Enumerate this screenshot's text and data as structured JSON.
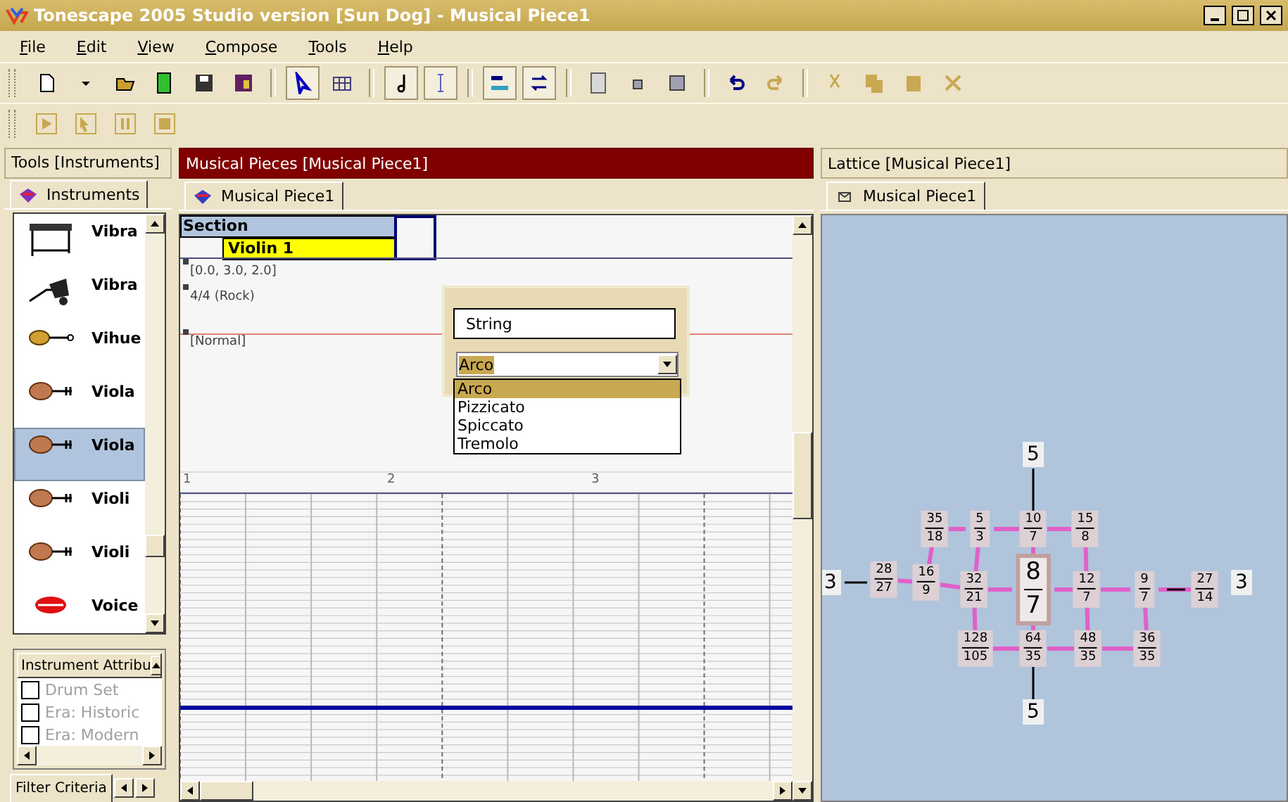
{
  "window": {
    "title": "Tonescape 2005 Studio  version [Sun Dog]  -  Musical Piece1"
  },
  "menu": [
    {
      "label": "File"
    },
    {
      "label": "Edit"
    },
    {
      "label": "View"
    },
    {
      "label": "Compose"
    },
    {
      "label": "Tools"
    },
    {
      "label": "Help"
    }
  ],
  "tools_panel": {
    "title": "Tools  [Instruments]",
    "tab": "Instruments",
    "instruments": [
      {
        "name": "Vibra",
        "kind": "vibraphone",
        "selected": false
      },
      {
        "name": "Vibra",
        "kind": "pedal",
        "selected": false
      },
      {
        "name": "Vihue",
        "kind": "guitar",
        "selected": false
      },
      {
        "name": "Viola",
        "kind": "violin",
        "selected": false
      },
      {
        "name": "Viola",
        "kind": "violin",
        "selected": true
      },
      {
        "name": "Violi",
        "kind": "violin",
        "selected": false
      },
      {
        "name": "Violi",
        "kind": "violin",
        "selected": false
      },
      {
        "name": "Voice",
        "kind": "lips",
        "selected": false
      }
    ],
    "attributes": {
      "title": "Instrument Attribu",
      "items": [
        {
          "label": "Drum Set",
          "checked": false
        },
        {
          "label": "Era: Historic",
          "checked": false
        },
        {
          "label": "Era: Modern",
          "checked": false
        }
      ]
    },
    "filter_tab": "Filter Criteria"
  },
  "pieces_panel": {
    "title": "Musical Pieces  [Musical Piece1]",
    "tab": "Musical Piece1",
    "section": {
      "header": "Section",
      "track": "Violin 1"
    },
    "markers": [
      "[0.0, 3.0, 2.0]",
      "4/4 (Rock)",
      "[Normal]"
    ],
    "popup": {
      "field_value": "String",
      "combo_value": "Arco",
      "options": [
        {
          "label": "Arco",
          "selected": true
        },
        {
          "label": "Pizzicato",
          "selected": false
        },
        {
          "label": "Spiccato",
          "selected": false
        },
        {
          "label": "Tremolo",
          "selected": false
        }
      ]
    },
    "ruler": [
      "1",
      "2",
      "3"
    ]
  },
  "lattice_panel": {
    "title": "Lattice  [Musical Piece1]",
    "tab": "Musical Piece1",
    "axes": [
      {
        "label": "5"
      },
      {
        "label": "5"
      },
      {
        "label": "3"
      },
      {
        "label": "3"
      }
    ],
    "nodes": [
      {
        "num": "35",
        "den": "18",
        "center": false
      },
      {
        "num": "5",
        "den": "3",
        "center": false
      },
      {
        "num": "10",
        "den": "7",
        "center": false
      },
      {
        "num": "15",
        "den": "8",
        "center": false
      },
      {
        "num": "28",
        "den": "27",
        "center": false
      },
      {
        "num": "16",
        "den": "9",
        "center": false
      },
      {
        "num": "32",
        "den": "21",
        "center": false
      },
      {
        "num": "8",
        "den": "7",
        "center": true
      },
      {
        "num": "12",
        "den": "7",
        "center": false
      },
      {
        "num": "9",
        "den": "7",
        "center": false
      },
      {
        "num": "27",
        "den": "14",
        "center": false
      },
      {
        "num": "128",
        "den": "105",
        "center": false
      },
      {
        "num": "64",
        "den": "35",
        "center": false
      },
      {
        "num": "48",
        "den": "35",
        "center": false
      },
      {
        "num": "36",
        "den": "35",
        "center": false
      }
    ]
  }
}
